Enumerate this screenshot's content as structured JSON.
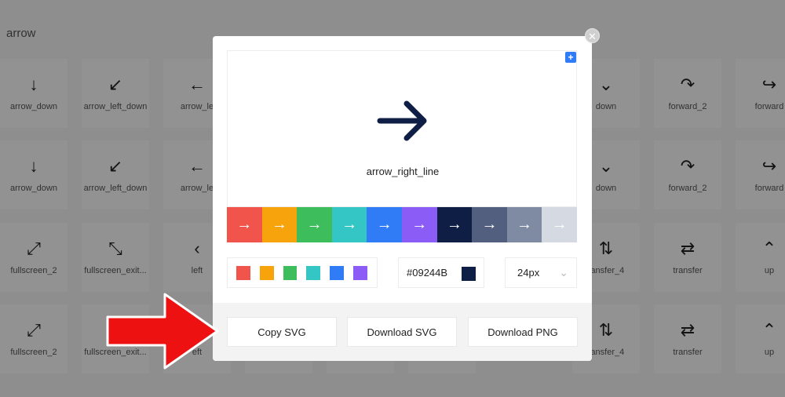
{
  "search": {
    "query": "arrow"
  },
  "icon_grid": {
    "rows": [
      [
        {
          "glyph": "↓",
          "label": "arrow_down"
        },
        {
          "glyph": "↙",
          "label": "arrow_left_down"
        },
        {
          "glyph": "←",
          "label": "arrow_le"
        },
        {
          "glyph": "",
          "label": ""
        },
        {
          "glyph": "",
          "label": ""
        },
        {
          "glyph": "",
          "label": ""
        },
        {
          "glyph": "⌄",
          "label": "down"
        },
        {
          "glyph": "↷",
          "label": "forward_2"
        },
        {
          "glyph": "↪",
          "label": "forward"
        }
      ],
      [
        {
          "glyph": "↓",
          "label": "arrow_down"
        },
        {
          "glyph": "↙",
          "label": "arrow_left_down"
        },
        {
          "glyph": "←",
          "label": "arrow_le"
        },
        {
          "glyph": "",
          "label": ""
        },
        {
          "glyph": "",
          "label": ""
        },
        {
          "glyph": "",
          "label": ""
        },
        {
          "glyph": "⌄",
          "label": "down"
        },
        {
          "glyph": "↷",
          "label": "forward_2"
        },
        {
          "glyph": "↪",
          "label": "forward"
        }
      ],
      [
        {
          "glyph": "⤢",
          "label": "fullscreen_2"
        },
        {
          "glyph": "⤡",
          "label": "fullscreen_exit..."
        },
        {
          "glyph": "‹",
          "label": "left"
        },
        {
          "glyph": "",
          "label": ""
        },
        {
          "glyph": "",
          "label": ""
        },
        {
          "glyph": "",
          "label": ""
        },
        {
          "glyph": "⇅",
          "label": "ransfer_4"
        },
        {
          "glyph": "⇄",
          "label": "transfer"
        },
        {
          "glyph": "⌃",
          "label": "up"
        }
      ],
      [
        {
          "glyph": "⤢",
          "label": "fullscreen_2"
        },
        {
          "glyph": "⤡",
          "label": "fullscreen_exit..."
        },
        {
          "glyph": "‹",
          "label": "eft"
        },
        {
          "glyph": "",
          "label": ""
        },
        {
          "glyph": "",
          "label": ""
        },
        {
          "glyph": "",
          "label": ""
        },
        {
          "glyph": "⇅",
          "label": "ransfer_4"
        },
        {
          "glyph": "⇄",
          "label": "transfer"
        },
        {
          "glyph": "⌃",
          "label": "up"
        }
      ]
    ]
  },
  "modal": {
    "close_glyph": "✕",
    "add_glyph": "+",
    "icon_name": "arrow_right_line",
    "preview_icon": "arrow-right-line-icon",
    "swatch_glyph": "→",
    "swatches": [
      "#f0544a",
      "#f7a30b",
      "#3ebd5c",
      "#34c5c5",
      "#2f7cf6",
      "#8b5cf6",
      "#0f1e45",
      "#525f7f",
      "#7f8aa3",
      "#d5d9e2"
    ],
    "colors": [
      "#f0544a",
      "#f7a30b",
      "#3ebd5c",
      "#34c5c5",
      "#2f7cf6",
      "#8b5cf6"
    ],
    "hex_value": "#09244B",
    "hex_chip_color": "#0f1e45",
    "size_value": "24px",
    "size_chevron": "⌄",
    "buttons": {
      "copy_svg": "Copy SVG",
      "download_svg": "Download SVG",
      "download_png": "Download PNG"
    }
  },
  "annotation": {
    "arrow_color": "#ee1111",
    "arrow_shape": "red-pointer-arrow"
  }
}
